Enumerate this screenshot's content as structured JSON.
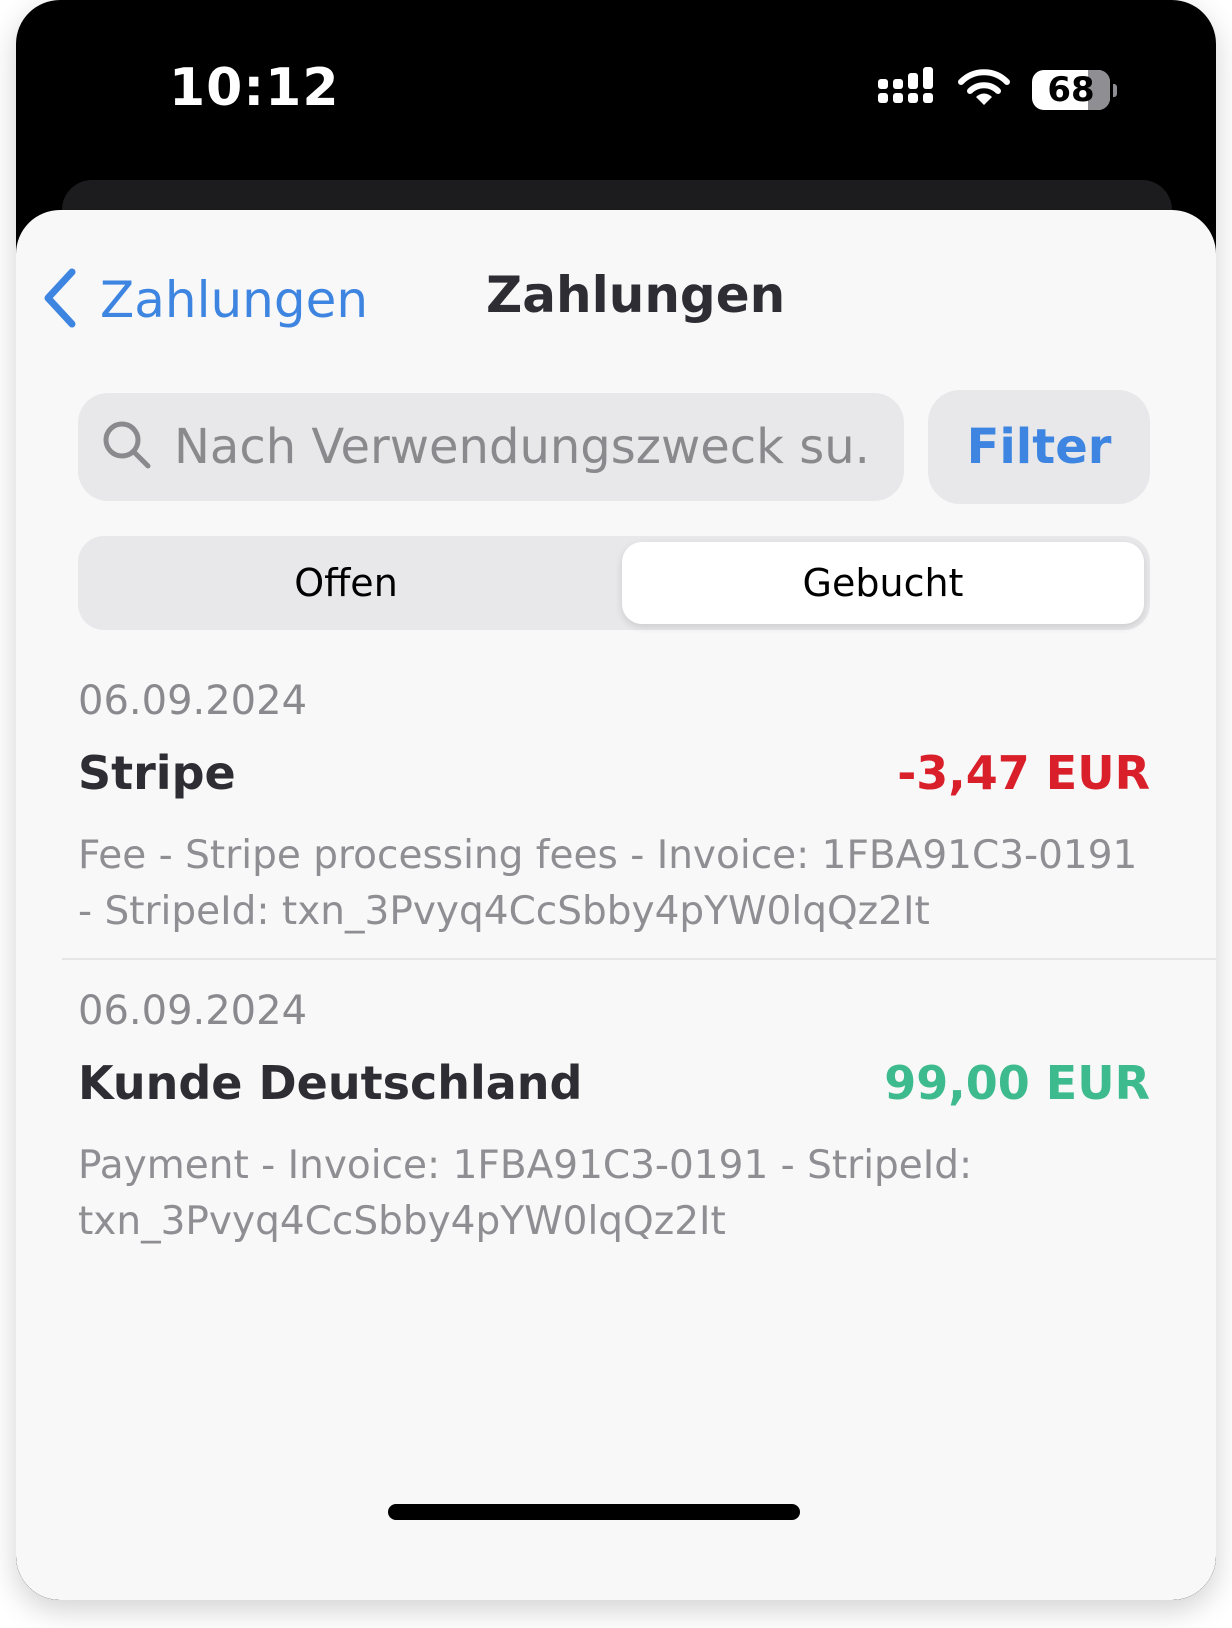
{
  "status_bar": {
    "time": "10:12",
    "battery_level": "68",
    "icons": [
      "cellular-signal-icon",
      "wifi-icon",
      "battery-icon"
    ]
  },
  "nav": {
    "back_label": "Zahlungen",
    "title": "Zahlungen"
  },
  "search": {
    "placeholder": "Nach Verwendungszweck su...",
    "value": ""
  },
  "filter": {
    "label": "Filter"
  },
  "segments": {
    "items": [
      {
        "label": "Offen",
        "selected": false
      },
      {
        "label": "Gebucht",
        "selected": true
      }
    ]
  },
  "transactions": [
    {
      "date": "06.09.2024",
      "name": "Stripe",
      "amount": "-3,47 EUR",
      "description": "Fee - Stripe processing fees - Invoice: 1FBA91C3-0191 - StripeId: txn_3Pvyq4CcSbby4pYW0lqQz2It"
    },
    {
      "date": "06.09.2024",
      "name": "Kunde Deutschland",
      "amount": "99,00 EUR",
      "description": "Payment - Invoice: 1FBA91C3-0191 - StripeId: txn_3Pvyq4CcSbby4pYW0lqQz2It"
    }
  ],
  "colors": {
    "accent": "#3d85e0",
    "negative": "#d9202a",
    "positive": "#3dbb8f",
    "background": "#f8f8f9"
  }
}
